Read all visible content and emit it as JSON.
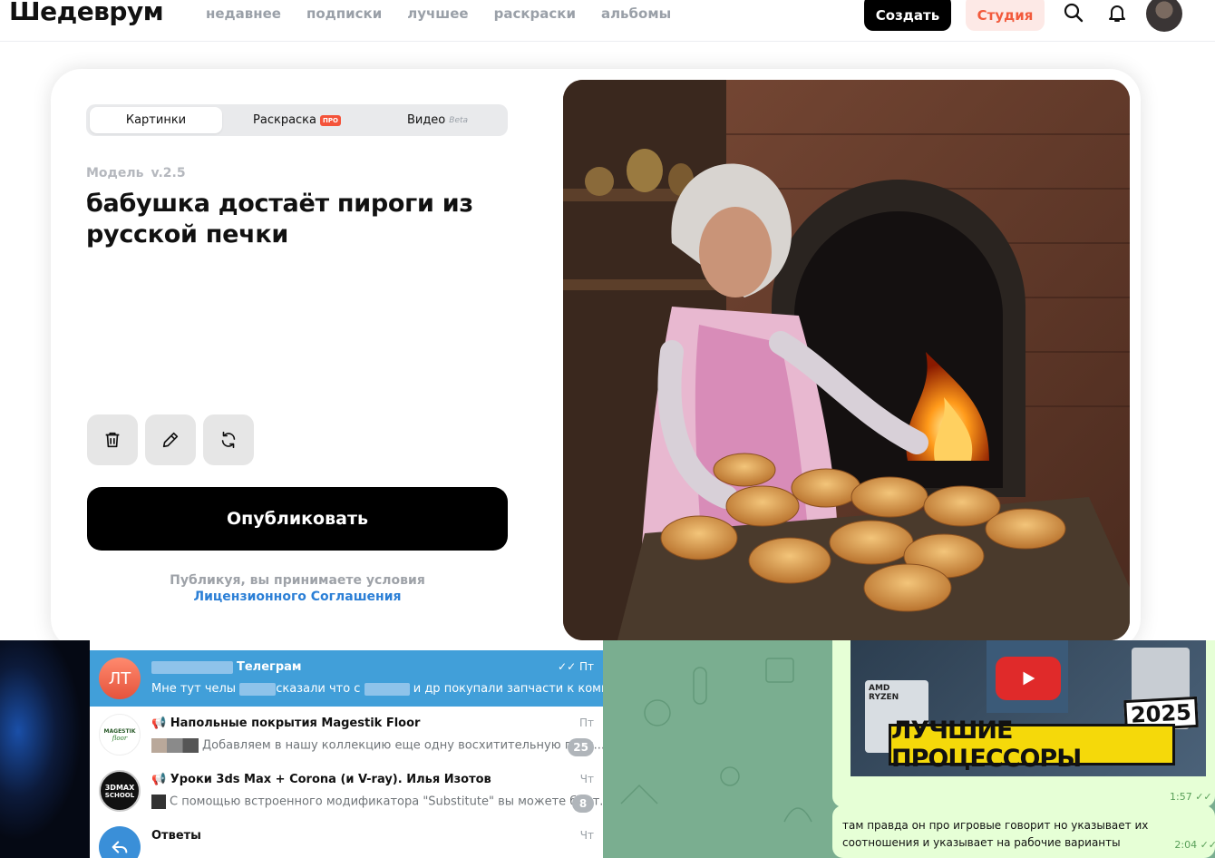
{
  "header": {
    "logo": "Шедеврум",
    "nav": [
      "недавнее",
      "подписки",
      "лучшее",
      "раскраски",
      "альбомы"
    ],
    "create_label": "Создать",
    "studio_label": "Студия"
  },
  "editor": {
    "tabs": [
      {
        "label": "Картинки",
        "badge": ""
      },
      {
        "label": "Раскраска",
        "badge": "ПРО"
      },
      {
        "label": "Видео",
        "badge": "Beta"
      }
    ],
    "model_label": "Модель",
    "model_version": "v.2.5",
    "prompt": "бабушка достаёт пироги из русской печки",
    "publish_label": "Опубликовать",
    "terms_text": "Публикуя, вы принимаете условия",
    "terms_link": "Лицензионного Соглашения"
  },
  "telegram": {
    "chats": [
      {
        "avatar": "ЛТ",
        "name": "Телеграм",
        "message_a": "Мне тут челы",
        "message_b": "сказали что с",
        "message_c": "и др покупали запчасти к компу (п...",
        "time": "Пт",
        "selected": true
      },
      {
        "avatar": "",
        "name": "Напольные покрытия Magestik Floor",
        "message": "Добавляем в нашу коллекцию еще одну восхитительную пози...",
        "time": "Пт",
        "count": "25",
        "logo_line1": "MAGESTIK",
        "logo_line2": "floor"
      },
      {
        "avatar": "",
        "name": "Уроки 3ds Max + Corona (и V-ray). Илья Изотов",
        "message": "С помощью встроенного модификатора \"Substitute\" вы можете быст...",
        "time": "Чт",
        "count": "8",
        "logo_line1": "3DMAX",
        "logo_line2": "SCHOOL"
      },
      {
        "avatar": "",
        "name": "Ответы",
        "message": "",
        "time": "Чт"
      }
    ],
    "video_thumb": {
      "year": "2025",
      "title": "ЛУЧШИЕ ПРОЦЕССОРЫ",
      "brand_a": "AMD",
      "brand_b": "RYZEN"
    },
    "media_time": "1:57",
    "message_text": "там правда он про игровые говорит но указывает их соотношения и указывает на рабочие варианты",
    "message_time": "2:04"
  }
}
